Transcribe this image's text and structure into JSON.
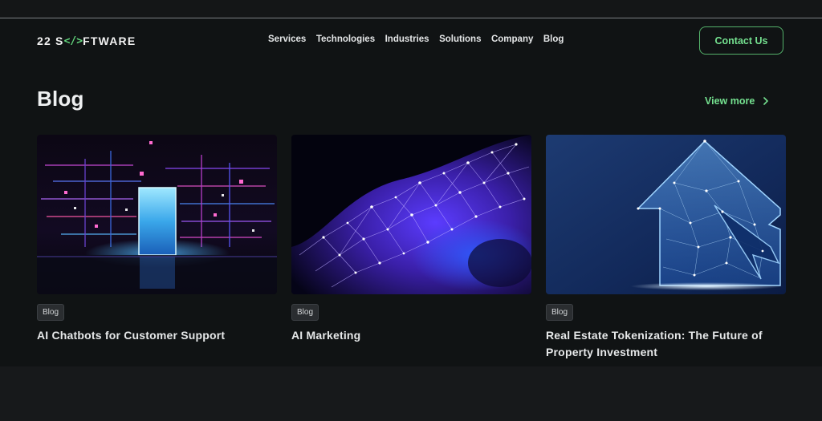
{
  "brand": {
    "logo_prefix": "22 S",
    "logo_code": "</>",
    "logo_suffix": "FTWARE",
    "accent_color": "#74e08f"
  },
  "nav": {
    "items": [
      {
        "label": "Services"
      },
      {
        "label": "Technologies"
      },
      {
        "label": "Industries"
      },
      {
        "label": "Solutions"
      },
      {
        "label": "Company"
      },
      {
        "label": "Blog"
      }
    ],
    "contact_label": "Contact Us"
  },
  "section": {
    "title": "Blog",
    "view_more_label": "View more",
    "view_more_icon": "chevron-right-icon"
  },
  "cards": [
    {
      "tag": "Blog",
      "title": "AI Chatbots for Customer Support",
      "image": "circuit-portal-image"
    },
    {
      "tag": "Blog",
      "title": "AI Marketing",
      "image": "particle-network-image"
    },
    {
      "tag": "Blog",
      "title": "Real Estate Tokenization: The Future of Property Investment",
      "image": "digital-house-image"
    }
  ]
}
